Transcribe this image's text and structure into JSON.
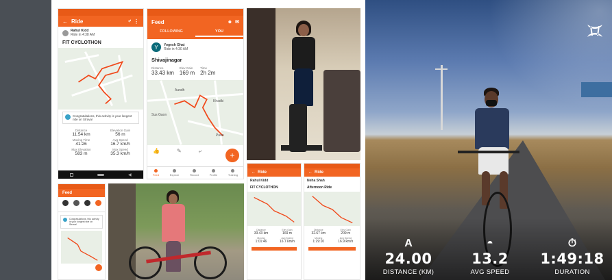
{
  "colors": {
    "strava_orange": "#f26522",
    "side_bar": "#4a4f55"
  },
  "panel1": {
    "header_title": "Ride",
    "athlete_name": "Rahul Kidd",
    "athlete_sub": "Ride in 4:38 AM",
    "activity_title": "FIT CYCLOTHON",
    "congrats_text": "Congratulations, this activity is your longest ride on Strava!",
    "stats": [
      {
        "label": "Distance",
        "value": "11.54 km"
      },
      {
        "label": "Elevation Gain",
        "value": "56 m"
      },
      {
        "label": "Moving Time",
        "value": "41:26"
      },
      {
        "label": "Avg Speed",
        "value": "16.7 km/h"
      },
      {
        "label": "Max Elevation",
        "value": "583 m"
      },
      {
        "label": "Max Speed",
        "value": "35.3 km/h"
      }
    ]
  },
  "panel2": {
    "header_title": "Feed",
    "tab_following": "FOLLOWING",
    "tab_you": "YOU",
    "athlete_initial": "Y",
    "athlete_name": "Yogesh Ghat",
    "athlete_sub": "Ride in 4:30 AM",
    "activity_title": "Shivajinagar",
    "stats": [
      {
        "label": "Distance",
        "value": "33.43 km"
      },
      {
        "label": "Elev Gain",
        "value": "169 m"
      },
      {
        "label": "Time",
        "value": "2h 2m"
      }
    ],
    "map_labels": [
      "Khadki",
      "Aundh",
      "Sus Gaon",
      "Pune"
    ],
    "nav": [
      "Feed",
      "Explore",
      "Record",
      "Profile",
      "Training"
    ]
  },
  "panel4": {
    "header_title": "Ride",
    "athlete_name": "Rahul Kidd",
    "activity_title": "FIT CYCLOTHON",
    "stats": [
      {
        "label": "Distance",
        "value": "33.43 km"
      },
      {
        "label": "Elev Gain",
        "value": "169 m"
      },
      {
        "label": "Moving",
        "value": "1:01:46"
      },
      {
        "label": "Avg Speed",
        "value": "16.7 km/h"
      }
    ]
  },
  "panel5": {
    "header_title": "Ride",
    "athlete_name": "Neha Shah",
    "activity_title": "Afternoon Ride",
    "stats": [
      {
        "label": "Distance",
        "value": "32.67 km"
      },
      {
        "label": "Elev Gain",
        "value": "209 m"
      },
      {
        "label": "Moving",
        "value": "1:29:10"
      },
      {
        "label": "Avg Speed",
        "value": "16.9 km/h"
      }
    ]
  },
  "panel6": {
    "header_title": "Feed",
    "congrats_text": "Congratulations, this activity is your longest ride on Strava!"
  },
  "overlay": {
    "metrics": [
      {
        "icon": "bike-icon",
        "glyph": "A",
        "value": "24.00",
        "label": "DISTANCE (KM)"
      },
      {
        "icon": "speedometer-icon",
        "glyph": "◓",
        "value": "13.2",
        "label": "AVG SPEED"
      },
      {
        "icon": "stopwatch-icon",
        "glyph": "⏱",
        "value": "1:49:18",
        "label": "DURATION"
      }
    ]
  }
}
